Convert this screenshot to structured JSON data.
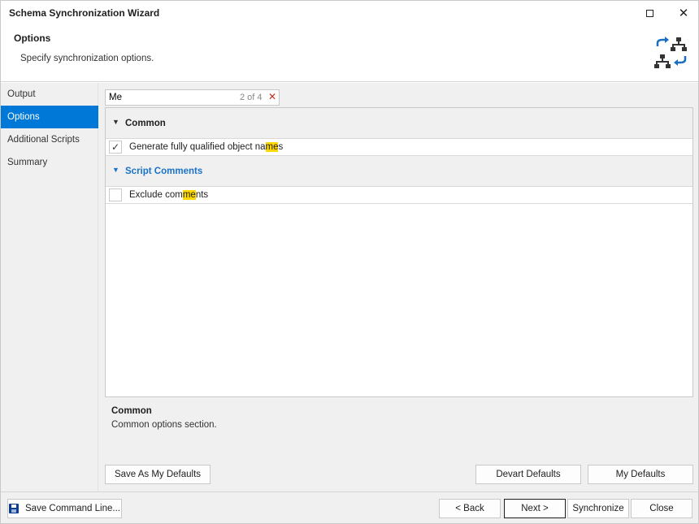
{
  "window": {
    "title": "Schema Synchronization Wizard"
  },
  "header": {
    "title": "Options",
    "subtitle": "Specify synchronization options.",
    "icon": "schema-sync-icon"
  },
  "nav": {
    "items": [
      {
        "label": "Output"
      },
      {
        "label": "Options"
      },
      {
        "label": "Additional Scripts"
      },
      {
        "label": "Summary"
      }
    ],
    "active": "Options"
  },
  "search": {
    "value": "Me",
    "match_count": "2 of 4"
  },
  "groups": [
    {
      "label": "Common",
      "options": [
        {
          "label_before": "Generate fully qualified object na",
          "label_match": "me",
          "label_after": "s",
          "checked": true
        }
      ]
    },
    {
      "label": "Script Comments",
      "options": [
        {
          "label_before": "Exclude com",
          "label_match": "me",
          "label_after": "nts",
          "checked": false
        }
      ]
    }
  ],
  "description": {
    "title": "Common",
    "text": "Common options section."
  },
  "buttons": {
    "save_as_my_defaults": "Save As My Defaults",
    "devart_defaults": "Devart Defaults",
    "my_defaults": "My Defaults",
    "save_command_line": "Save Command Line...",
    "back": "< Back",
    "next": "Next >",
    "synchronize": "Synchronize",
    "close": "Close"
  },
  "colors": {
    "accent": "#0078d7",
    "group_link": "#1a73c7",
    "highlight": "#ffd800"
  }
}
